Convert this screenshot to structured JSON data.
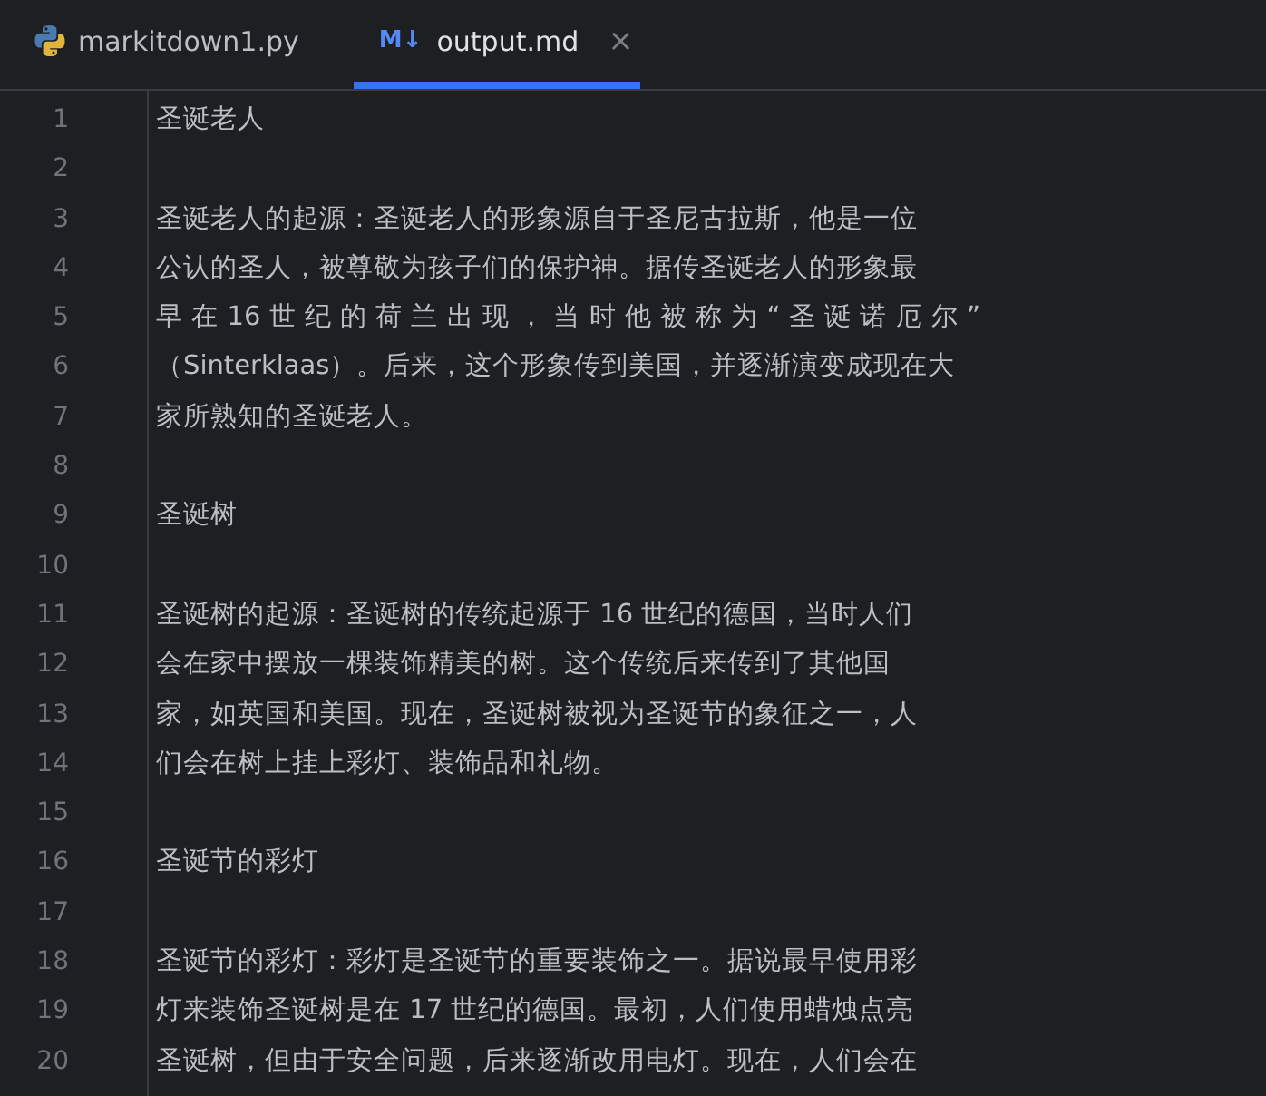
{
  "tabs": [
    {
      "label": "markitdown1.py",
      "kind": "python",
      "selected": false
    },
    {
      "label": "output.md",
      "kind": "markdown",
      "badge": "M↓",
      "close": "×",
      "selected": true
    }
  ],
  "editor": {
    "lines": [
      {
        "number": "1",
        "text": "圣诞老人"
      },
      {
        "number": "2"
      },
      {
        "number": "3",
        "text": "圣诞老人的起源：圣诞老人的形象源自于圣尼古拉斯，他是一位"
      },
      {
        "number": "4",
        "text": "公认的圣人，被尊敬为孩子们的保护神。据传圣诞老人的形象最"
      },
      {
        "number": "5",
        "text": "早 在 16 世 纪 的 荷 兰 出 现 ， 当 时 他 被 称 为 “ 圣 诞 诺 厄 尔 ”"
      },
      {
        "number": "6",
        "text": "（Sinterklaas）。后来，这个形象传到美国，并逐渐演变成现在大"
      },
      {
        "number": "7",
        "text": "家所熟知的圣诞老人。"
      },
      {
        "number": "8"
      },
      {
        "number": "9",
        "text": "圣诞树"
      },
      {
        "number": "10"
      },
      {
        "number": "11",
        "text": "圣诞树的起源：圣诞树的传统起源于 16 世纪的德国，当时人们"
      },
      {
        "number": "12",
        "text": "会在家中摆放一棵装饰精美的树。这个传统后来传到了其他国"
      },
      {
        "number": "13",
        "text": "家，如英国和美国。现在，圣诞树被视为圣诞节的象征之一，人"
      },
      {
        "number": "14",
        "text": "们会在树上挂上彩灯、装饰品和礼物。"
      },
      {
        "number": "15"
      },
      {
        "number": "16",
        "text": "圣诞节的彩灯"
      },
      {
        "number": "17"
      },
      {
        "number": "18",
        "text": "圣诞节的彩灯：彩灯是圣诞节的重要装饰之一。据说最早使用彩"
      },
      {
        "number": "19",
        "text": "灯来装饰圣诞树是在 17 世纪的德国。最初，人们使用蜡烛点亮"
      },
      {
        "number": "20",
        "text": "圣诞树，但由于安全问题，后来逐渐改用电灯。现在，人们会在"
      }
    ]
  }
}
